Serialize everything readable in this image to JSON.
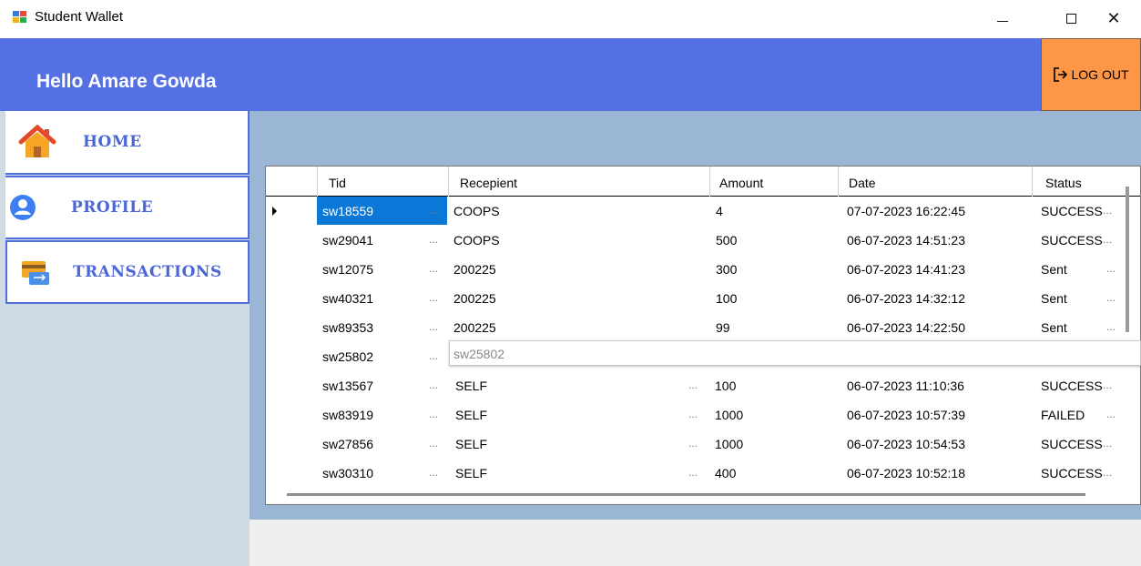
{
  "window": {
    "title": "Student Wallet",
    "minimize_glyph": "—",
    "close_glyph": "✕"
  },
  "header": {
    "greeting": "Hello Amare Gowda",
    "logout_label": "LOG OUT",
    "logout_icon": "logout-icon"
  },
  "sidebar": {
    "items": [
      {
        "label": "HOME",
        "icon": "home-icon"
      },
      {
        "label": "PROFILE",
        "icon": "user-icon"
      },
      {
        "label": "TRANSACTIONS",
        "icon": "card-icon"
      }
    ]
  },
  "grid": {
    "columns": [
      "Tid",
      "Recepient",
      "Amount",
      "Date",
      "Status"
    ],
    "rows": [
      {
        "tid": "sw18559",
        "recipient": "COOPS",
        "amount": "4",
        "date": "07-07-2023 16:22:45",
        "status": "SUCCESS"
      },
      {
        "tid": "sw29041",
        "recipient": "COOPS",
        "amount": "500",
        "date": "06-07-2023 14:51:23",
        "status": "SUCCESS"
      },
      {
        "tid": "sw12075",
        "recipient": "200225",
        "amount": "300",
        "date": "06-07-2023 14:41:23",
        "status": "Sent"
      },
      {
        "tid": "sw40321",
        "recipient": "200225",
        "amount": "100",
        "date": "06-07-2023 14:32:12",
        "status": "Sent"
      },
      {
        "tid": "sw89353",
        "recipient": "200225",
        "amount": "99",
        "date": "06-07-2023 14:22:50",
        "status": "Sent"
      },
      {
        "tid": "sw25802",
        "recipient": "",
        "amount": "",
        "date": "",
        "status": ""
      },
      {
        "tid": "sw13567",
        "recipient": "SELF",
        "amount": "100",
        "date": "06-07-2023 11:10:36",
        "status": "SUCCESS"
      },
      {
        "tid": "sw83919",
        "recipient": "SELF",
        "amount": "1000",
        "date": "06-07-2023 10:57:39",
        "status": "FAILED"
      },
      {
        "tid": "sw27856",
        "recipient": "SELF",
        "amount": "1000",
        "date": "06-07-2023 10:54:53",
        "status": "SUCCESS"
      },
      {
        "tid": "sw30310",
        "recipient": "SELF",
        "amount": "400",
        "date": "06-07-2023 10:52:18",
        "status": "SUCCESS"
      }
    ],
    "editor_value": "sw25802",
    "ellipsis": "..."
  },
  "colors": {
    "header": "#5470e3",
    "logout": "#fd9646",
    "sidebar_bg": "#d0dae3",
    "nav_text": "#4b66d6",
    "panel": "#9bb6d4",
    "selection": "#0b78d7"
  }
}
